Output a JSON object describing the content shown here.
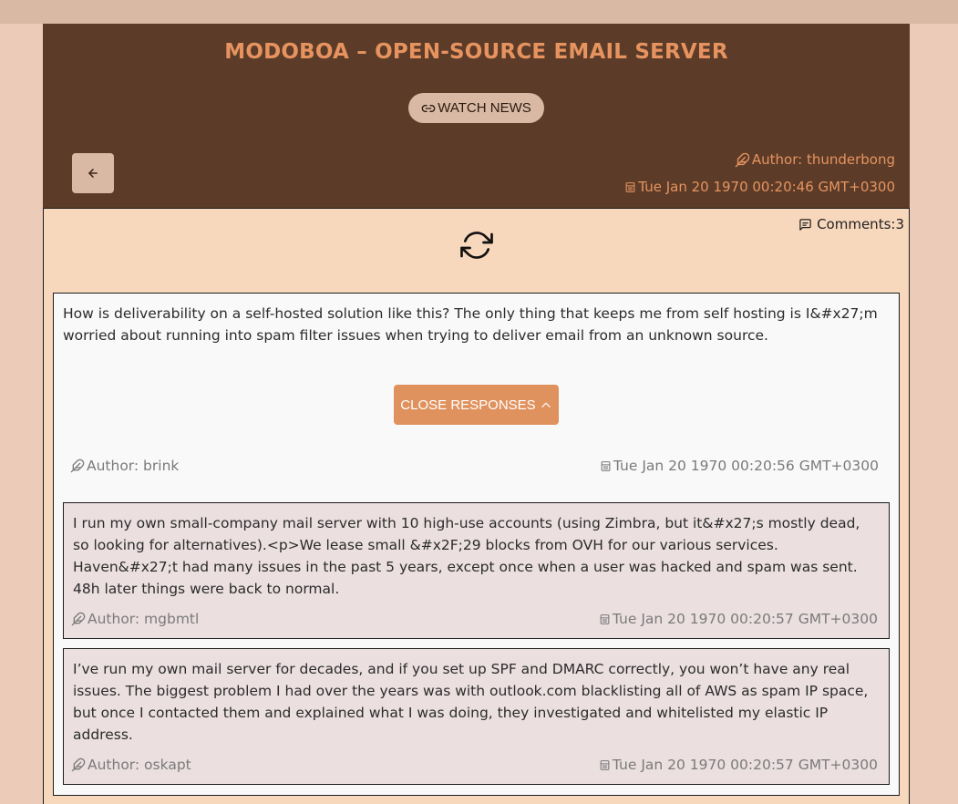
{
  "header": {
    "title": "MODOBOA – OPEN-SOURCE EMAIL SERVER",
    "watch_label": "WATCH NEWS",
    "author": "Author: thunderbong",
    "date": "Tue Jan 20 1970 00:20:46 GMT+0300"
  },
  "comments": {
    "label": "Comments:",
    "count": "3"
  },
  "post": {
    "text": "How is deliverability on a self-hosted solution like this? The only thing that keeps me from self hosting is I&#x27;m worried about running into spam filter issues when trying to deliver email from an unknown source.",
    "close_label": "CLOSE RESPONSES",
    "author": "Author: brink",
    "date": "Tue Jan 20 1970 00:20:56 GMT+0300"
  },
  "replies": [
    {
      "text": "I run my own small-company mail server with 10 high-use accounts (using Zimbra, but it&#x27;s mostly dead, so looking for alternatives).<p>We lease small &#x2F;29 blocks from OVH for our various services. Haven&#x27;t had many issues in the past 5 years, except once when a user was hacked and spam was sent. 48h later things were back to normal.",
      "author": "Author: mgbmtl",
      "date": "Tue Jan 20 1970 00:20:57 GMT+0300"
    },
    {
      "text": "I’ve run my own mail server for decades, and if you set up SPF and DMARC correctly, you won’t have any real issues. The biggest problem I had over the years was with outlook.com blacklisting all of AWS as spam IP space, but once I contacted them and explained what I was doing, they investigated and whitelisted my elastic IP address.",
      "author": "Author: oskapt",
      "date": "Tue Jan 20 1970 00:20:57 GMT+0300"
    }
  ],
  "icons": {
    "link": "link-icon",
    "back": "arrow-left-icon",
    "author": "feather-icon",
    "date": "calendar-icon",
    "comments": "message-square-icon",
    "refresh": "refresh-icon",
    "chevron": "chevron-up-icon"
  },
  "colors": {
    "header_bg": "#5c3c28",
    "accent": "#e69360",
    "button_bg": "#d9b9a3",
    "content_bg": "#f8d8bd",
    "reply_bg": "#ebdfe0"
  }
}
